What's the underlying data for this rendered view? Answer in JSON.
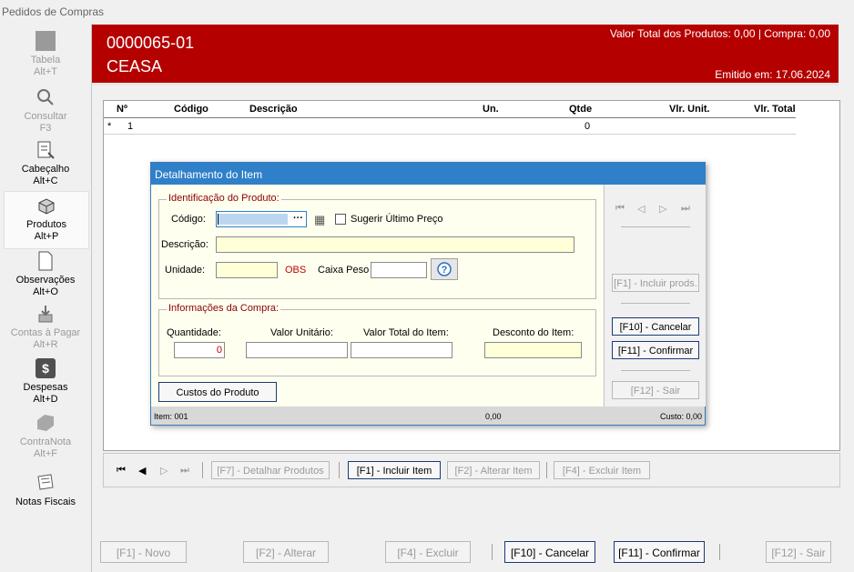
{
  "window": {
    "title": "Pedidos de Compras"
  },
  "sidebar": {
    "items": [
      {
        "label": "Tabela",
        "shortcut": "Alt+T",
        "icon": "table-icon"
      },
      {
        "label": "Consultar",
        "shortcut": "F3",
        "icon": "search-icon"
      },
      {
        "label": "Cabeçalho",
        "shortcut": "Alt+C",
        "icon": "header-icon"
      },
      {
        "label": "Produtos",
        "shortcut": "Alt+P",
        "icon": "products-icon"
      },
      {
        "label": "Observações",
        "shortcut": "Alt+O",
        "icon": "notes-icon"
      },
      {
        "label": "Contas à Pagar",
        "shortcut": "Alt+R",
        "icon": "payables-icon"
      },
      {
        "label": "Despesas",
        "shortcut": "Alt+D",
        "icon": "dollar-icon"
      },
      {
        "label": "ContraNota",
        "shortcut": "Alt+F",
        "icon": "contranota-icon"
      },
      {
        "label": "Notas Fiscais",
        "shortcut": "",
        "icon": "invoices-icon"
      }
    ]
  },
  "header": {
    "order_number": "0000065-01",
    "supplier": "CEASA",
    "totals": "Valor Total dos Produtos: 0,00 | Compra: 0,00",
    "issued": "Emitido em: 17.06.2024",
    "color": "#b50000"
  },
  "grid": {
    "columns": [
      "Nº",
      "Código",
      "Descrição",
      "Un.",
      "Qtde",
      "Vlr. Unit.",
      "Vlr. Total"
    ],
    "rows": [
      {
        "marker": "*",
        "n": "1",
        "codigo": "",
        "descricao": "",
        "un": "",
        "qtde": "0",
        "vlr_unit": "",
        "vlr_total": ""
      }
    ]
  },
  "navbar": {
    "detalhar": "[F7] - Detalhar Produtos",
    "incluir": "[F1] - Incluir Item",
    "alterar": "[F2] - Alterar Item",
    "excluir": "[F4] - Excluir  Item"
  },
  "bottombar": {
    "novo": "[F1] - Novo",
    "alterar": "[F2] - Alterar",
    "excluir": "[F4] - Excluir",
    "cancelar": "[F10] - Cancelar",
    "confirmar": "[F11] - Confirmar",
    "sair": "[F12] - Sair"
  },
  "dialog": {
    "title": "Detalhamento do Item",
    "ident_legend": "Identificação do Produto:",
    "codigo_label": "Código:",
    "sugerir_label": "Sugerir Último Preço",
    "descricao_label": "Descrição:",
    "unidade_label": "Unidade:",
    "obs_label": "OBS",
    "caixa_peso_label": "Caixa Peso",
    "info_legend": "Informações da Compra:",
    "quantidade_label": "Quantidade:",
    "valor_unitario_label": "Valor Unitário:",
    "valor_total_label": "Valor Total do Item:",
    "desconto_label": "Desconto do Item:",
    "quantidade_value": "0",
    "custos_button": "Custos do Produto",
    "incluir_prods": "[F1] - Incluir prods.",
    "cancelar": "[F10] - Cancelar",
    "confirmar": "[F11] - Confirmar",
    "sair": "[F12] - Sair",
    "status_item": "Item: 001",
    "status_value": "0,00",
    "status_custo": "Custo: 0,00"
  }
}
